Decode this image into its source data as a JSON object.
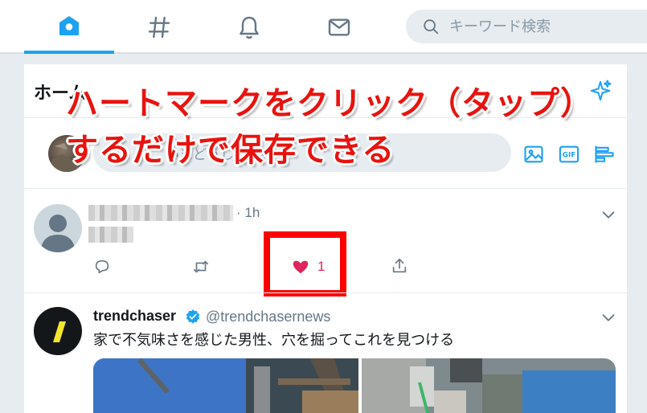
{
  "nav": {
    "items": [
      {
        "icon": "home-icon",
        "active": true
      },
      {
        "icon": "hashtag-icon",
        "active": false
      },
      {
        "icon": "bell-icon",
        "active": false
      },
      {
        "icon": "mail-icon",
        "active": false
      }
    ],
    "search_placeholder": "キーワード検索"
  },
  "timeline": {
    "title": "ホーム",
    "compose_placeholder": "いまどうしてる？"
  },
  "tweets": [
    {
      "time": "· 1h",
      "like_count": "1"
    },
    {
      "name": "trendchaser",
      "handle": "@trendchasernews",
      "text": "家で不気味さを感じた男性、穴を掘ってこれを見つける"
    }
  ],
  "overlay": {
    "line1": "ハートマークをクリック（タップ）",
    "line2": "するだけで保存できる"
  },
  "colors": {
    "accent": "#1da1f2",
    "like": "#e0245e",
    "annotation_red": "#e8130f",
    "highlight_box": "#ff0000"
  }
}
